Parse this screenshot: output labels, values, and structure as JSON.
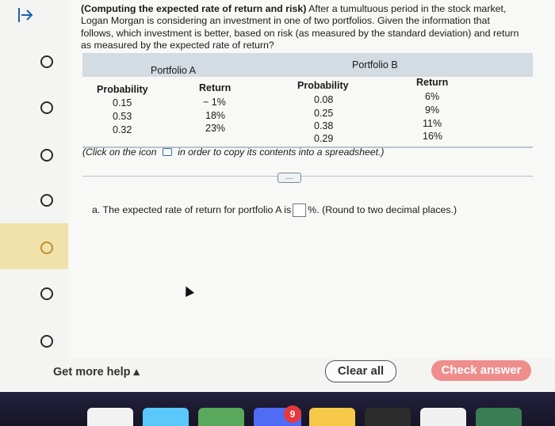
{
  "problem": {
    "title": "(Computing the expected rate of return and risk)",
    "text": "After a tumultuous period in the stock market, Logan Morgan is considering an investment in one of two portfolios. Given the information that follows, which investment is better, based on risk (as measured by the standard deviation) and return as measured by the expected rate of return?"
  },
  "table": {
    "portfolio_a": "Portfolio A",
    "portfolio_b": "Portfolio B",
    "headers": [
      "Probability",
      "Return",
      "Probability",
      "Return"
    ],
    "a_prob": [
      "0.15",
      "0.53",
      "0.32"
    ],
    "a_ret": [
      "− 1%",
      "18%",
      "23%"
    ],
    "b_prob": [
      "0.08",
      "0.25",
      "0.38",
      "0.29"
    ],
    "b_ret": [
      "6%",
      "9%",
      "11%",
      "16%"
    ]
  },
  "note": {
    "before": "(Click on the icon",
    "after": "in order to copy its contents into a spreadsheet.)"
  },
  "more_label": "....",
  "question": {
    "before": "a. The expected rate of return for portfolio A is",
    "after": "%. (Round to two decimal places.)"
  },
  "footer": {
    "help": "Get more help ▴",
    "clear": "Clear all",
    "check": "Check answer"
  },
  "dock": {
    "badge": "9"
  }
}
